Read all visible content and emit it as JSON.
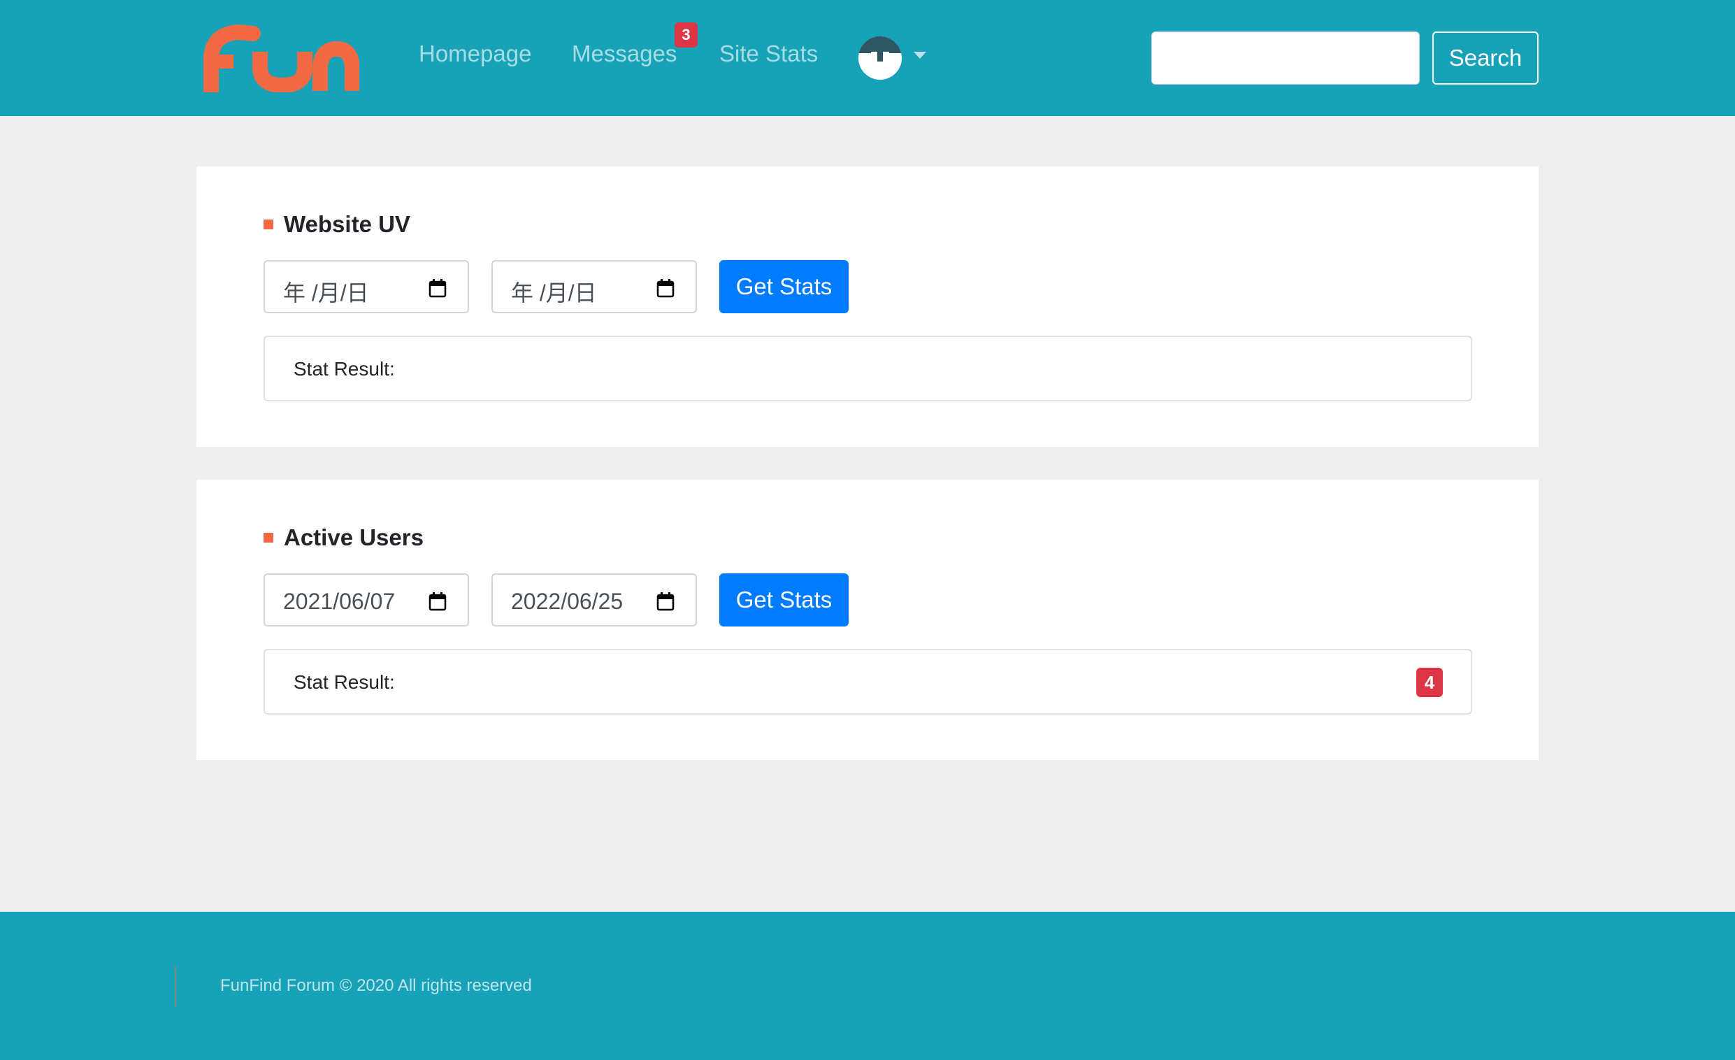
{
  "brand": {
    "logo_text": "fun",
    "logo_color": "#f16a44",
    "header_color": "#17a2b8"
  },
  "nav": {
    "items": [
      {
        "label": "Homepage"
      },
      {
        "label": "Messages",
        "badge": "3"
      },
      {
        "label": "Site Stats"
      }
    ],
    "avatar_icon": "user-avatar-icon",
    "dropdown_icon": "caret-down-icon"
  },
  "search": {
    "value": "",
    "placeholder": "",
    "button_label": "Search"
  },
  "cards": [
    {
      "title": "Website UV",
      "marker_color": "#f16a44",
      "start_date": "年 /月/日",
      "end_date": "年 /月/日",
      "button_label": "Get Stats",
      "result_label": "Stat Result:",
      "result_value": ""
    },
    {
      "title": "Active Users",
      "marker_color": "#f16a44",
      "start_date": "2021/06/07",
      "end_date": "2022/06/25",
      "button_label": "Get Stats",
      "result_label": "Stat Result:",
      "result_value": "4"
    }
  ],
  "footer": {
    "text": "FunFind Forum © 2020 All rights reserved"
  },
  "colors": {
    "primary_button": "#007bff",
    "badge": "#dc3545",
    "page_background": "#efefef"
  }
}
